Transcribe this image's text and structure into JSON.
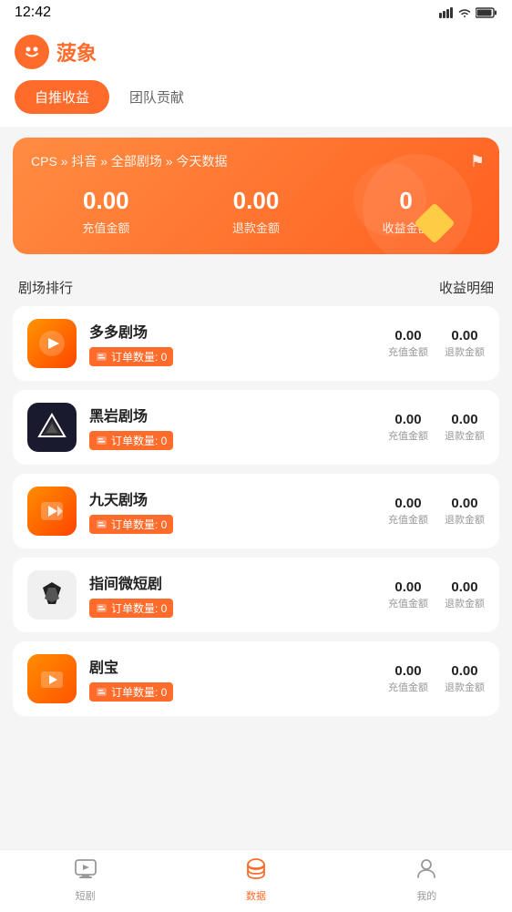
{
  "statusBar": {
    "time": "12:42",
    "icons": "▲ ▼ ▲"
  },
  "header": {
    "appTitle": "菠象"
  },
  "tabs": {
    "active": "自推收益",
    "inactive": "团队贡献"
  },
  "card": {
    "breadcrumb": "CPS » 抖音 » 全部剧场 » 今天数据",
    "stats": [
      {
        "value": "0.00",
        "label": "充值金额"
      },
      {
        "value": "0.00",
        "label": "退款金额"
      },
      {
        "value": "0",
        "label": "收益金额"
      }
    ]
  },
  "sectionHeaders": {
    "left": "剧场排行",
    "right": "收益明细"
  },
  "theaters": [
    {
      "name": "多多剧场",
      "orderCount": "0",
      "rechargeAmount": "0.00",
      "refundAmount": "0.00",
      "logoType": "duoduo"
    },
    {
      "name": "黑岩剧场",
      "orderCount": "0",
      "rechargeAmount": "0.00",
      "refundAmount": "0.00",
      "logoType": "heiyan"
    },
    {
      "name": "九天剧场",
      "orderCount": "0",
      "rechargeAmount": "0.00",
      "refundAmount": "0.00",
      "logoType": "jiutian"
    },
    {
      "name": "指间微短剧",
      "orderCount": "0",
      "rechargeAmount": "0.00",
      "refundAmount": "0.00",
      "logoType": "zhijian"
    },
    {
      "name": "剧宝",
      "orderCount": "0",
      "rechargeAmount": "0.00",
      "refundAmount": "0.00",
      "logoType": "jubao"
    }
  ],
  "amountLabels": {
    "recharge": "充值金额",
    "refund": "退款金额"
  },
  "orderLabel": "订单数量: ",
  "bottomNav": [
    {
      "icon": "🎬",
      "label": "短剧",
      "active": false
    },
    {
      "icon": "❤",
      "label": "数据",
      "active": true
    },
    {
      "icon": "👤",
      "label": "我的",
      "active": false
    }
  ]
}
